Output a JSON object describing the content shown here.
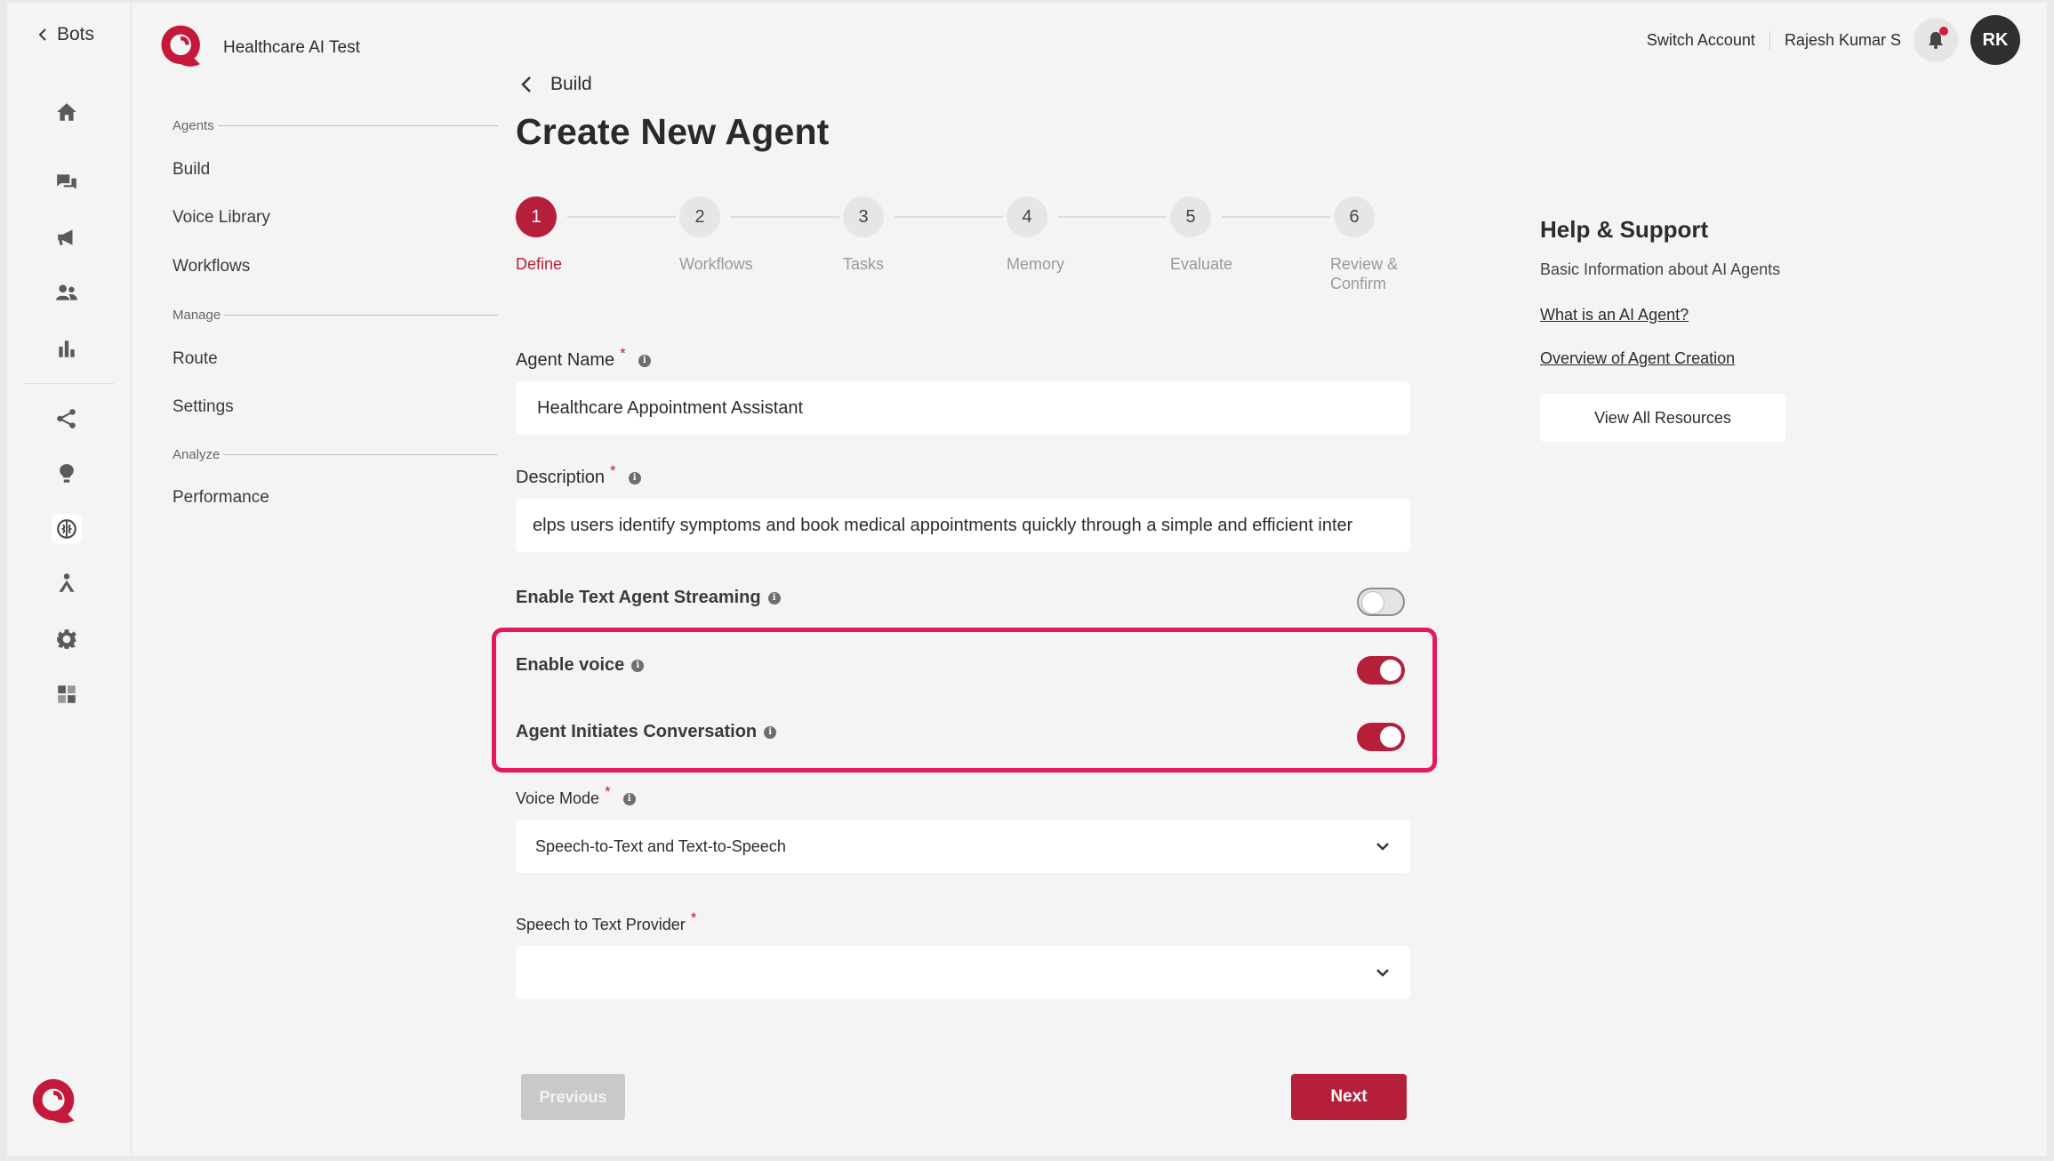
{
  "rail": {
    "back_label": "Bots",
    "icons": [
      "home-icon",
      "chat-icon",
      "megaphone-icon",
      "users-icon",
      "bar-chart-icon",
      "share-icon",
      "lightbulb-icon",
      "brain-icon",
      "agent-icon",
      "gear-icon",
      "grid-icon"
    ],
    "active_icon": "brain-icon"
  },
  "brand": {
    "name": "Healthcare AI Test"
  },
  "nav": {
    "sections": [
      {
        "label": "Agents",
        "items": [
          "Build",
          "Voice Library",
          "Workflows"
        ]
      },
      {
        "label": "Manage",
        "items": [
          "Route",
          "Settings"
        ]
      },
      {
        "label": "Analyze",
        "items": [
          "Performance"
        ]
      }
    ]
  },
  "header": {
    "switch_account": "Switch Account",
    "user_name": "Rajesh Kumar S",
    "avatar_initials": "RK"
  },
  "breadcrumb": {
    "label": "Build"
  },
  "page": {
    "title": "Create New Agent"
  },
  "stepper": {
    "steps": [
      {
        "number": "1",
        "label": "Define",
        "active": true
      },
      {
        "number": "2",
        "label": "Workflows"
      },
      {
        "number": "3",
        "label": "Tasks"
      },
      {
        "number": "4",
        "label": "Memory"
      },
      {
        "number": "5",
        "label": "Evaluate"
      },
      {
        "number": "6",
        "label_line1": "Review &",
        "label_line2": "Confirm"
      }
    ]
  },
  "form": {
    "agent_name_label": "Agent Name",
    "agent_name_value": "Healthcare Appointment Assistant",
    "description_label": "Description",
    "description_value": "elps users identify symptoms and book medical appointments quickly through a simple and efficient inter",
    "required_mark": "*",
    "streaming_label": "Enable Text Agent Streaming",
    "streaming_on": false,
    "voice_label": "Enable voice",
    "voice_on": true,
    "initiates_label": "Agent Initiates Conversation",
    "initiates_on": true,
    "voice_mode_label": "Voice Mode",
    "voice_mode_value": "Speech-to-Text and Text-to-Speech",
    "stt_provider_label": "Speech to Text Provider",
    "stt_provider_value": ""
  },
  "actions": {
    "previous": "Previous",
    "next": "Next"
  },
  "help": {
    "title": "Help & Support",
    "subtitle": "Basic Information about AI Agents",
    "link1": "What is an AI Agent?",
    "link2": "Overview of Agent Creation",
    "button": "View All Resources"
  },
  "colors": {
    "accent": "#b51f3a",
    "highlight": "#e5195a"
  }
}
